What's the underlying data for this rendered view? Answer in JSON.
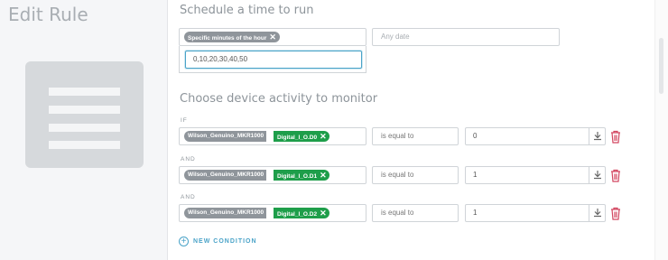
{
  "left_panel": {
    "title": "Edit Rule"
  },
  "schedule": {
    "title": "Schedule a time to run",
    "chip_label": "Specific minutes of the hour",
    "date_placeholder": "Any date",
    "minutes_value": "0,10,20,30,40,50"
  },
  "activity": {
    "title": "Choose device activity to monitor",
    "conditions": [
      {
        "label": "IF",
        "device": "Wilson_Genuino_MKR1000",
        "pin": "Digital_I_O.D0",
        "operator": "is equal to",
        "value": "0"
      },
      {
        "label": "AND",
        "device": "Wilson_Genuino_MKR1000",
        "pin": "Digital_I_O.D1",
        "operator": "is equal to",
        "value": "1"
      },
      {
        "label": "AND",
        "device": "Wilson_Genuino_MKR1000",
        "pin": "Digital_I_O.D2",
        "operator": "is equal to",
        "value": "1"
      }
    ],
    "new_condition_label": "NEW CONDITION"
  },
  "colors": {
    "accent": "#4aa3c8",
    "pin_chip": "#1e9e4a",
    "device_chip": "#8f959b",
    "danger": "#d2455f"
  }
}
